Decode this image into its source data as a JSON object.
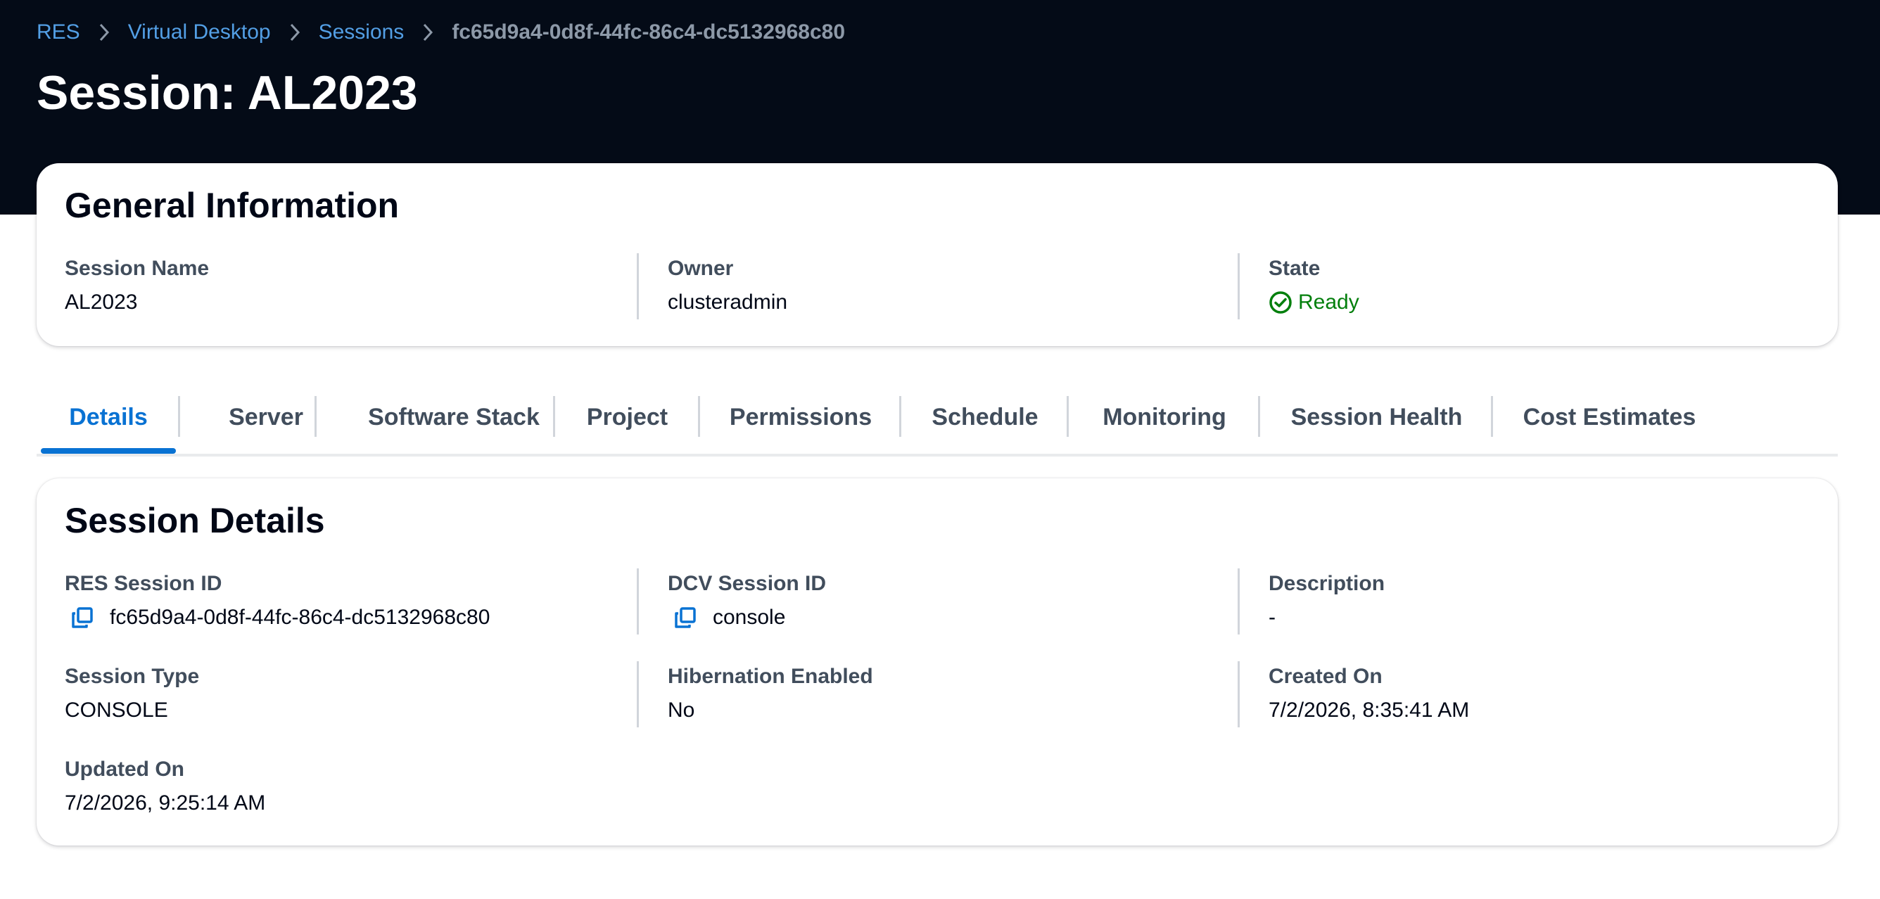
{
  "breadcrumb": {
    "items": [
      "RES",
      "Virtual Desktop",
      "Sessions"
    ],
    "current": "fc65d9a4-0d8f-44fc-86c4-dc5132968c80"
  },
  "page_title": "Session: AL2023",
  "general_info": {
    "title": "General Information",
    "session_name_label": "Session Name",
    "session_name": "AL2023",
    "owner_label": "Owner",
    "owner": "clusteradmin",
    "state_label": "State",
    "state": "Ready",
    "state_icon": "check-circle-icon"
  },
  "tabs": [
    {
      "label": "Details",
      "active": true
    },
    {
      "label": "Server"
    },
    {
      "label": "Software Stack"
    },
    {
      "label": "Project"
    },
    {
      "label": "Permissions"
    },
    {
      "label": "Schedule"
    },
    {
      "label": "Monitoring"
    },
    {
      "label": "Session Health"
    },
    {
      "label": "Cost Estimates"
    }
  ],
  "session_details": {
    "title": "Session Details",
    "res_session_id_label": "RES Session ID",
    "res_session_id": "fc65d9a4-0d8f-44fc-86c4-dc5132968c80",
    "dcv_session_id_label": "DCV Session ID",
    "dcv_session_id": "console",
    "description_label": "Description",
    "description": "-",
    "session_type_label": "Session Type",
    "session_type": "CONSOLE",
    "hibernation_label": "Hibernation Enabled",
    "hibernation": "No",
    "created_on_label": "Created On",
    "created_on": "7/2/2026, 8:35:41 AM",
    "updated_on_label": "Updated On",
    "updated_on": "7/2/2026, 9:25:14 AM",
    "copy_icon": "copy-icon"
  },
  "colors": {
    "header_bg": "#040b17",
    "link": "#539fe5",
    "accent": "#0972d3",
    "success": "#037f0c"
  }
}
